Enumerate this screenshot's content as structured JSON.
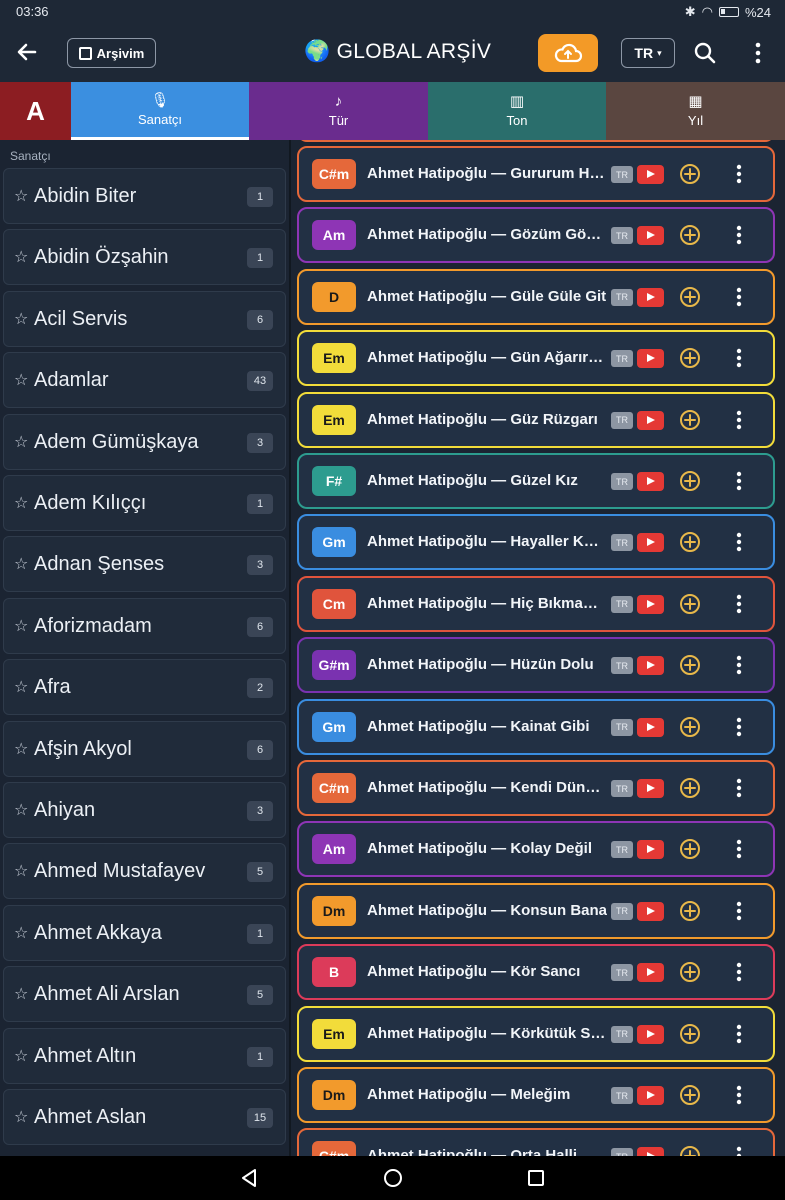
{
  "status": {
    "time": "03:36",
    "battery": "%24"
  },
  "header": {
    "back": "←",
    "archive_label": "Arşivim",
    "title": "🌍 GLOBAL ARŞİV",
    "lang": "TR"
  },
  "tabs": {
    "letter": "A",
    "items": [
      {
        "label": "Sanatçı",
        "color": "#3b8fe0"
      },
      {
        "label": "Tür",
        "color": "#6a2c8e"
      },
      {
        "label": "Ton",
        "color": "#2a6e6c"
      },
      {
        "label": "Yıl",
        "color": "#5a4640"
      }
    ]
  },
  "artists": {
    "section_label": "Sanatçı",
    "items": [
      {
        "name": "Abidin Biter",
        "count": "1"
      },
      {
        "name": "Abidin Özşahin",
        "count": "1"
      },
      {
        "name": "Acil Servis",
        "count": "6"
      },
      {
        "name": "Adamlar",
        "count": "43"
      },
      {
        "name": "Adem Gümüşkaya",
        "count": "3"
      },
      {
        "name": "Adem Kılıççı",
        "count": "1"
      },
      {
        "name": "Adnan Şenses",
        "count": "3"
      },
      {
        "name": "Aforizmadam",
        "count": "6"
      },
      {
        "name": "Afra",
        "count": "2"
      },
      {
        "name": "Afşin Akyol",
        "count": "6"
      },
      {
        "name": "Ahiyan",
        "count": "3"
      },
      {
        "name": "Ahmed Mustafayev",
        "count": "5"
      },
      {
        "name": "Ahmet Akkaya",
        "count": "1"
      },
      {
        "name": "Ahmet Ali Arslan",
        "count": "5"
      },
      {
        "name": "Ahmet Altın",
        "count": "1"
      },
      {
        "name": "Ahmet Aslan",
        "count": "15"
      }
    ]
  },
  "songs": {
    "lang_badge": "TR",
    "items": [
      {
        "key": "C#m",
        "title": "Ahmet Hatipoğlu — Gururum Hatalarım",
        "color": "#e5683a"
      },
      {
        "key": "Am",
        "title": "Ahmet Hatipoğlu — Gözüm Gönlüm",
        "color": "#8e35b5"
      },
      {
        "key": "D",
        "title": "Ahmet Hatipoğlu — Güle Güle Git",
        "color": "#f29a2c"
      },
      {
        "key": "Em",
        "title": "Ahmet Hatipoğlu — Gün Ağarırken",
        "color": "#f2dc3a"
      },
      {
        "key": "Em",
        "title": "Ahmet Hatipoğlu — Güz Rüzgarı",
        "color": "#f2dc3a"
      },
      {
        "key": "F#",
        "title": "Ahmet Hatipoğlu — Güzel Kız",
        "color": "#2d9c8f"
      },
      {
        "key": "Gm",
        "title": "Ahmet Hatipoğlu — Hayaller Kurdum",
        "color": "#3a8de0"
      },
      {
        "key": "Cm",
        "title": "Ahmet Hatipoğlu — Hiç Bıkmadım",
        "color": "#e0543c"
      },
      {
        "key": "G#m",
        "title": "Ahmet Hatipoğlu — Hüzün Dolu",
        "color": "#7a32b0"
      },
      {
        "key": "Gm",
        "title": "Ahmet Hatipoğlu — Kainat Gibi",
        "color": "#3a8de0"
      },
      {
        "key": "C#m",
        "title": "Ahmet Hatipoğlu — Kendi Dünyam",
        "color": "#e5683a"
      },
      {
        "key": "Am",
        "title": "Ahmet Hatipoğlu — Kolay Değil",
        "color": "#8e35b5"
      },
      {
        "key": "Dm",
        "title": "Ahmet Hatipoğlu — Konsun Bana",
        "color": "#f29a2c"
      },
      {
        "key": "B",
        "title": "Ahmet Hatipoğlu — Kör Sancı",
        "color": "#dc3b5a"
      },
      {
        "key": "Em",
        "title": "Ahmet Hatipoğlu — Körkütük Sarhoş",
        "color": "#f2dc3a"
      },
      {
        "key": "Dm",
        "title": "Ahmet Hatipoğlu — Meleğim",
        "color": "#f29a2c"
      },
      {
        "key": "C#m",
        "title": "Ahmet Hatipoğlu — Orta Halli",
        "color": "#e5683a"
      }
    ]
  }
}
